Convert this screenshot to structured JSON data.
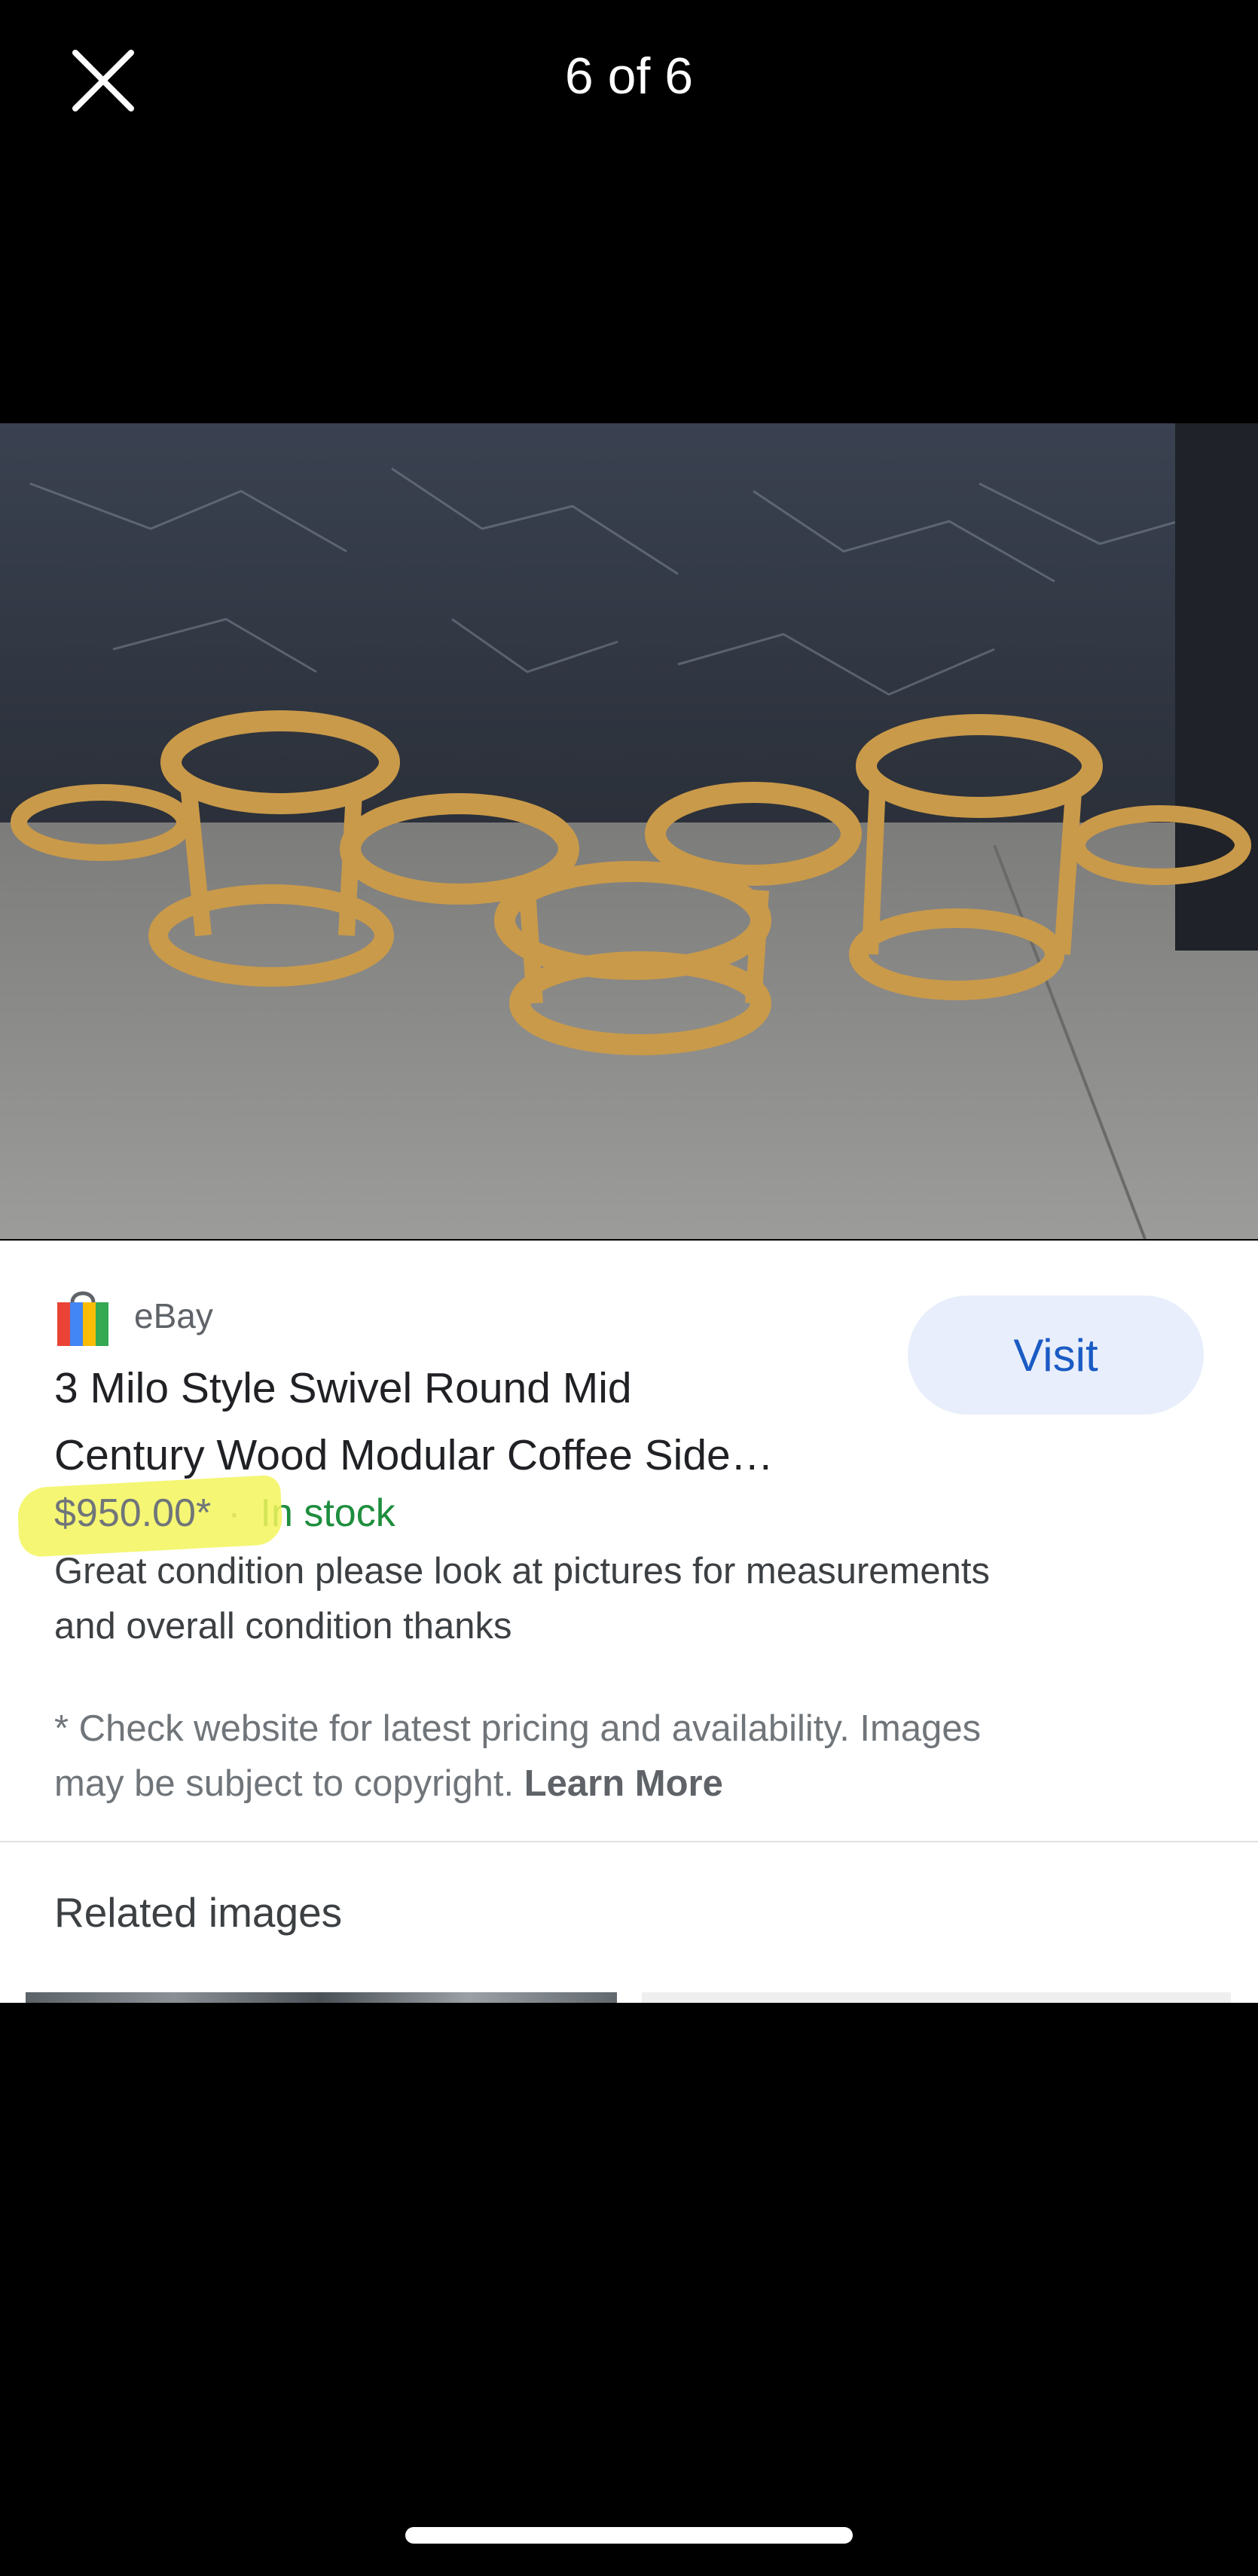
{
  "viewer": {
    "counter": "6 of 6",
    "close_icon": "close-icon"
  },
  "product": {
    "image_alt": "Wooden modular round coffee side tables",
    "source": "eBay",
    "source_icon": "shopping-bag-icon",
    "visit_label": "Visit",
    "title_line1": "3 Milo Style Swivel Round Mid",
    "title_line2": "Century Wood Modular Coffee Side…",
    "price": "$950.00*",
    "separator": "·",
    "stock": "In stock",
    "desc_line1": "Great condition please look at pictures for measurements",
    "desc_line2": "and overall condition thanks",
    "notice_line1": "* Check website for latest pricing and availability. Images",
    "notice_line2": "may be subject to copyright. ",
    "learn_more": "Learn More"
  },
  "related": {
    "heading": "Related images"
  },
  "colors": {
    "background": "#000000",
    "card": "#ffffff",
    "visit_bg": "#e8eefb",
    "visit_text": "#1a5bc4",
    "stock_green": "#1e8e3e",
    "highlight": "#f3f45a"
  }
}
